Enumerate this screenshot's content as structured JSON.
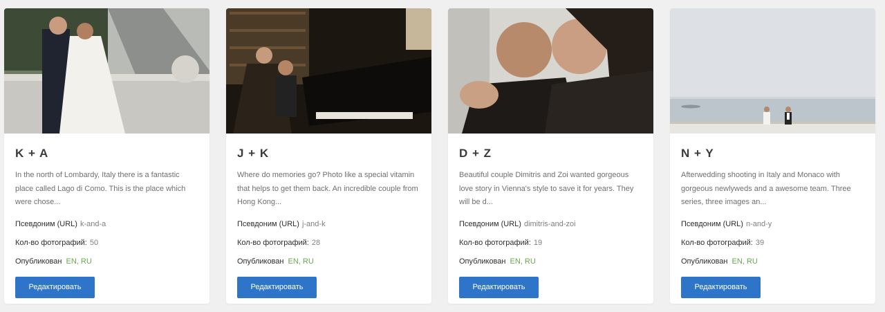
{
  "cards": [
    {
      "title": "K + A",
      "description": "In the north of Lombardy, Italy there is a fantastic place called Lago di Como. This is the place which were chose...",
      "alias_label": "Псевдоним (URL)",
      "alias": "k-and-a",
      "photos_label": "Кол-во фотографий:",
      "photos": "50",
      "published_label": "Опубликован",
      "published": "EN, RU",
      "edit_label": "Редактировать"
    },
    {
      "title": "J + K",
      "description": "Where do memories go? Photo like a special vitamin that helps to get them back. An incredible couple from Hong Kong...",
      "alias_label": "Псевдоним (URL)",
      "alias": "j-and-k",
      "photos_label": "Кол-во фотографий:",
      "photos": "28",
      "published_label": "Опубликован",
      "published": "EN, RU",
      "edit_label": "Редактировать"
    },
    {
      "title": "D + Z",
      "description": "Beautiful couple Dimitris and Zoi wanted gorgeous love story in Vienna's style to save it for years. They will be d...",
      "alias_label": "Псевдоним (URL)",
      "alias": "dimitris-and-zoi",
      "photos_label": "Кол-во фотографий:",
      "photos": "19",
      "published_label": "Опубликован",
      "published": "EN, RU",
      "edit_label": "Редактировать"
    },
    {
      "title": "N + Y",
      "description": "Afterwedding shooting in Italy and Monaco with gorgeous newlyweds and a awesome team. Three series, three images an...",
      "alias_label": "Псевдоним (URL)",
      "alias": "n-and-y",
      "photos_label": "Кол-во фотографий:",
      "photos": "39",
      "published_label": "Опубликован",
      "published": "EN, RU",
      "edit_label": "Редактировать"
    }
  ],
  "colors": {
    "page_background": "#f0f0f1",
    "button": "#2e75c9",
    "published_languages": "#6aa84f"
  }
}
